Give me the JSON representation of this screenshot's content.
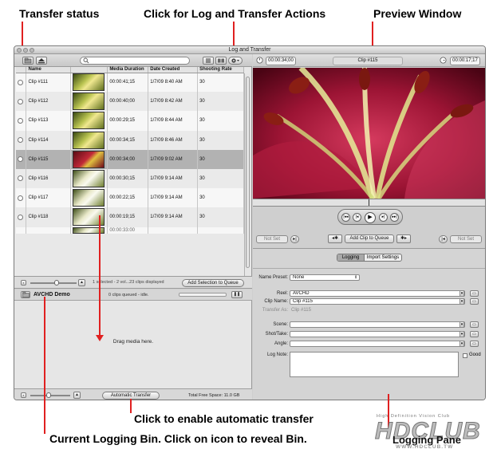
{
  "callouts": {
    "transfer_status": "Transfer status",
    "log_actions": "Click for Log and Transfer Actions",
    "preview_window": "Preview Window",
    "auto_transfer": "Click to enable automatic transfer",
    "logging_bin": "Current Logging Bin. Click on icon to reveal Bin.",
    "logging_pane": "Logging Pane"
  },
  "window": {
    "title": "Log and Transfer"
  },
  "browse": {
    "columns": [
      "Name",
      "Media Duration",
      "Date Created",
      "Shooting Rate"
    ],
    "clips": [
      {
        "name": "Clip #111",
        "duration": "00:00:41;15",
        "date": "1/7/09 8:40 AM",
        "rate": "30",
        "thumb": "g"
      },
      {
        "name": "Clip #112",
        "duration": "00:00:40;00",
        "date": "1/7/09 8:42 AM",
        "rate": "30",
        "thumb": "g"
      },
      {
        "name": "Clip #113",
        "duration": "00:00:29;15",
        "date": "1/7/09 8:44 AM",
        "rate": "30",
        "thumb": "g"
      },
      {
        "name": "Clip #114",
        "duration": "00:00:34;15",
        "date": "1/7/09 8:46 AM",
        "rate": "30",
        "thumb": "g"
      },
      {
        "name": "Clip #115",
        "duration": "00:00:34;00",
        "date": "1/7/09 9:02 AM",
        "rate": "30",
        "thumb": "r",
        "selected": true
      },
      {
        "name": "Clip #116",
        "duration": "00:00:30;15",
        "date": "1/7/09 9:14 AM",
        "rate": "30",
        "thumb": "w"
      },
      {
        "name": "Clip #117",
        "duration": "00:00:22;15",
        "date": "1/7/09 9:14 AM",
        "rate": "30",
        "thumb": "w"
      },
      {
        "name": "Clip #118",
        "duration": "00:00:19;15",
        "date": "1/7/09 9:14 AM",
        "rate": "30",
        "thumb": "w"
      }
    ],
    "partial_duration": "00:00:33:00",
    "status_text": "1 selected - 2 vol...23 clips displayed",
    "add_selection": "Add Selection to Queue"
  },
  "queue": {
    "bin_name": "AVCHD Demo",
    "status": "0 clips queued - idle.",
    "drag_text": "Drag media here.",
    "auto_transfer": "Automatic Transfer",
    "free_space": "Total Free Space: 11.0 GB"
  },
  "preview": {
    "tc_left": "00:00:34;00",
    "clip_name": "Clip #115",
    "tc_right": "00:00:17;17",
    "not_set_in": "Not Set",
    "not_set_out": "Not Set",
    "add_clip": "Add Clip to Queue"
  },
  "logging": {
    "tabs": [
      "Logging",
      "Import Settings"
    ],
    "name_preset_label": "Name Preset:",
    "name_preset_value": "None",
    "reel_label": "Reel:",
    "reel_value": "AVCHD",
    "clip_name_label": "Clip Name:",
    "clip_name_value": "Clip #115",
    "transfer_as_label": "Transfer As:",
    "transfer_as_value": "Clip #115",
    "scene_label": "Scene:",
    "shot_label": "Shot/Take:",
    "angle_label": "Angle:",
    "log_note_label": "Log Note:",
    "good_label": "Good"
  },
  "watermark": {
    "sub": "High Definition Vision Club",
    "logo": "HDCLUB",
    "url": "WWW.HDCLUB.TW"
  },
  "colors": {
    "callout_line": "#e02020"
  }
}
